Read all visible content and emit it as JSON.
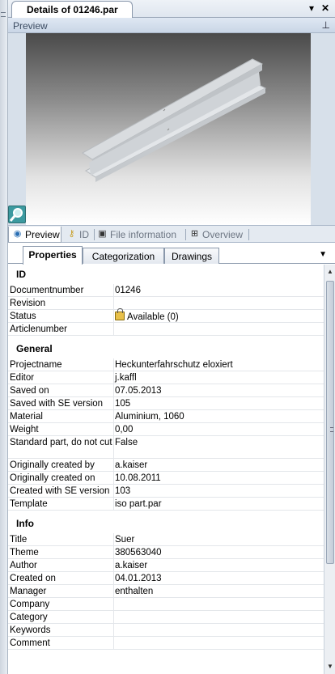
{
  "window": {
    "title": "Details of 01246.par"
  },
  "preview_header": {
    "label": "Preview"
  },
  "view_tabs": [
    {
      "label": "Preview",
      "icon": "eye-icon"
    },
    {
      "label": "ID",
      "icon": "key-icon"
    },
    {
      "label": "File information",
      "icon": "file-info-icon"
    },
    {
      "label": "Overview",
      "icon": "tree-icon"
    }
  ],
  "property_tabs": [
    "Properties",
    "Categorization",
    "Drawings"
  ],
  "sections": {
    "id": {
      "title": "ID",
      "rows": [
        {
          "key": "Documentnumber",
          "value": "01246"
        },
        {
          "key": "Revision",
          "value": ""
        },
        {
          "key": "Status",
          "value": "Available (0)"
        },
        {
          "key": "Articlenumber",
          "value": ""
        }
      ]
    },
    "general": {
      "title": "General",
      "rows": [
        {
          "key": "Projectname",
          "value": "Heckunterfahrschutz eloxiert"
        },
        {
          "key": "Editor",
          "value": "j.kaffl"
        },
        {
          "key": "Saved on",
          "value": "07.05.2013"
        },
        {
          "key": "Saved with SE version",
          "value": "105"
        },
        {
          "key": "Material",
          "value": "Aluminium, 1060"
        },
        {
          "key": "Weight",
          "value": "0,00"
        },
        {
          "key": "Standard part, do not cut",
          "value": "False"
        },
        {
          "key": "Originally created by",
          "value": "a.kaiser"
        },
        {
          "key": "Originally created on",
          "value": "10.08.2011"
        },
        {
          "key": "Created with SE version",
          "value": "103"
        },
        {
          "key": "Template",
          "value": "iso part.par"
        }
      ]
    },
    "info": {
      "title": "Info",
      "rows": [
        {
          "key": "Title",
          "value": "Suer"
        },
        {
          "key": "Theme",
          "value": "380563040"
        },
        {
          "key": "Author",
          "value": "a.kaiser"
        },
        {
          "key": "Created on",
          "value": "04.01.2013"
        },
        {
          "key": "Manager",
          "value": "enthalten"
        },
        {
          "key": "Company",
          "value": ""
        },
        {
          "key": "Category",
          "value": ""
        },
        {
          "key": "Keywords",
          "value": ""
        },
        {
          "key": "Comment",
          "value": ""
        }
      ]
    }
  }
}
